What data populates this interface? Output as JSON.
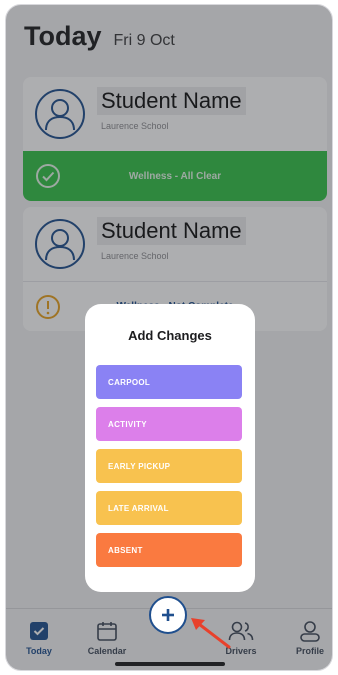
{
  "header": {
    "title": "Today",
    "date": "Fri 9 Oct"
  },
  "students": [
    {
      "name": "Student Name",
      "school": "Laurence School",
      "status": "Wellness - All Clear",
      "status_type": "clear",
      "color": "#34c247"
    },
    {
      "name": "Student Name",
      "school": "Laurence School",
      "status": "Wellness - Not Complete",
      "status_type": "incomplete",
      "color": "#e8a21f"
    }
  ],
  "modal": {
    "title": "Add Changes",
    "options": [
      {
        "label": "CARPOOL",
        "color": "#8a82f4"
      },
      {
        "label": "ACTIVITY",
        "color": "#dc7fea"
      },
      {
        "label": "EARLY PICKUP",
        "color": "#f8c24f"
      },
      {
        "label": "LATE ARRIVAL",
        "color": "#f8c24f"
      },
      {
        "label": "ABSENT",
        "color": "#fa7a40"
      }
    ]
  },
  "tabbar": {
    "tabs": [
      {
        "label": "Today",
        "icon": "check-square-icon",
        "active": true
      },
      {
        "label": "Calendar",
        "icon": "calendar-icon",
        "active": false
      },
      {
        "label": "Drivers",
        "icon": "drivers-icon",
        "active": false
      },
      {
        "label": "Profile",
        "icon": "profile-icon",
        "active": false
      }
    ],
    "center_button_icon": "plus-icon"
  },
  "colors": {
    "accent": "#1f4f8e",
    "arrow": "#e8412c"
  }
}
